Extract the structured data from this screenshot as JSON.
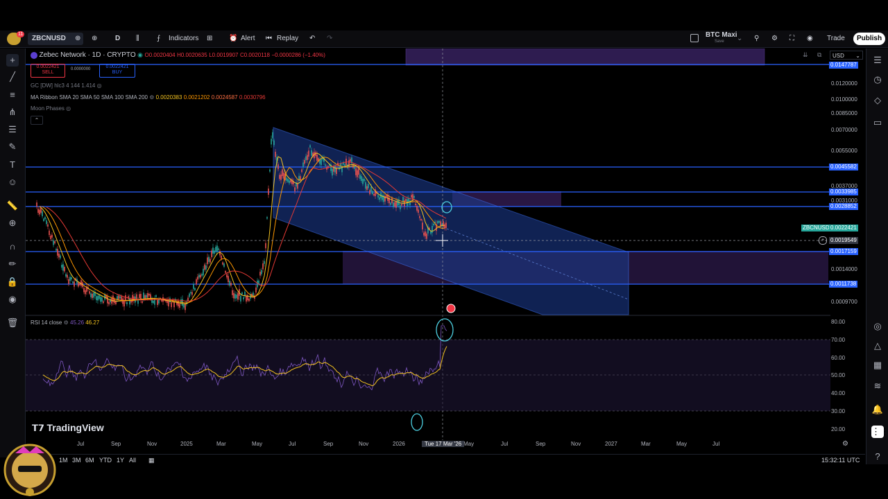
{
  "toolbar": {
    "symbol": "ZBCNUSD",
    "timeframe": "D",
    "indicators": "Indicators",
    "alert": "Alert",
    "replay": "Replay",
    "layout_name": "BTC Maxi",
    "layout_sub": "Save",
    "trade": "Trade",
    "publish": "Publish",
    "notif_count": "11"
  },
  "legend": {
    "title": "Zebec Network · 1D · CRYPTO",
    "ohlc_o": "O0.0020404",
    "ohlc_h": "H0.0020635",
    "ohlc_l": "L0.0019907",
    "ohlc_c": "C0.0020118",
    "change": "−0.0000286 (−1.40%)",
    "sell_price": "0.0022421",
    "sell_label": "SELL",
    "spread": "0.0000000",
    "buy_price": "0.0022421",
    "buy_label": "BUY",
    "ind1": "GC [DW] hlc3 4 144 1.414",
    "ind2_name": "MA Ribbon SMA 20 SMA 50 SMA 100 SMA 200",
    "ind2_v1": "0.0020383",
    "ind2_v2": "0.0021202",
    "ind2_v3": "0.0024587",
    "ind2_v4": "0.0030796",
    "ind3": "Moon Phases",
    "currency": "USD"
  },
  "y_axis": [
    {
      "label": "0.0120000"
    },
    {
      "label": "0.0100000"
    },
    {
      "label": "0.0085000"
    },
    {
      "label": "0.0070000"
    },
    {
      "label": "0.0055000"
    },
    {
      "label": "0.0037000"
    },
    {
      "label": "0.0031000"
    },
    {
      "label": "0.0014000"
    },
    {
      "label": "0.0009700"
    }
  ],
  "y_tags": [
    {
      "label": "0.0147787"
    },
    {
      "label": "0.0045582"
    },
    {
      "label": "0.0033985"
    },
    {
      "label": "0.0028852"
    },
    {
      "label": "0.0022421"
    },
    {
      "label": "0.0019549"
    },
    {
      "label": "0.0017159"
    },
    {
      "label": "0.0011738"
    }
  ],
  "current_symbol_tag": "ZBCNUSD",
  "rsi": {
    "label": "RSI 14 close",
    "v1": "45.26",
    "v2": "46.27",
    "axis": [
      "80.00",
      "70.00",
      "60.00",
      "50.00",
      "40.00",
      "30.00",
      "20.00"
    ]
  },
  "x_axis": [
    "Jul",
    "Sep",
    "Nov",
    "2025",
    "Mar",
    "May",
    "Jul",
    "Sep",
    "Nov",
    "2026",
    "May",
    "Jul",
    "Sep",
    "Nov",
    "2027",
    "Mar",
    "May",
    "Jul"
  ],
  "crosshair_date": "Tue 17 Mar '26",
  "bottom": {
    "ranges": [
      "1M",
      "3M",
      "6M",
      "YTD",
      "1Y",
      "All"
    ],
    "time": "15:32:11 UTC"
  },
  "branding": "TradingView",
  "colors": {
    "accent": "#2962ff",
    "zone": "#4a2a7a",
    "channel": "#1c3a8a"
  }
}
